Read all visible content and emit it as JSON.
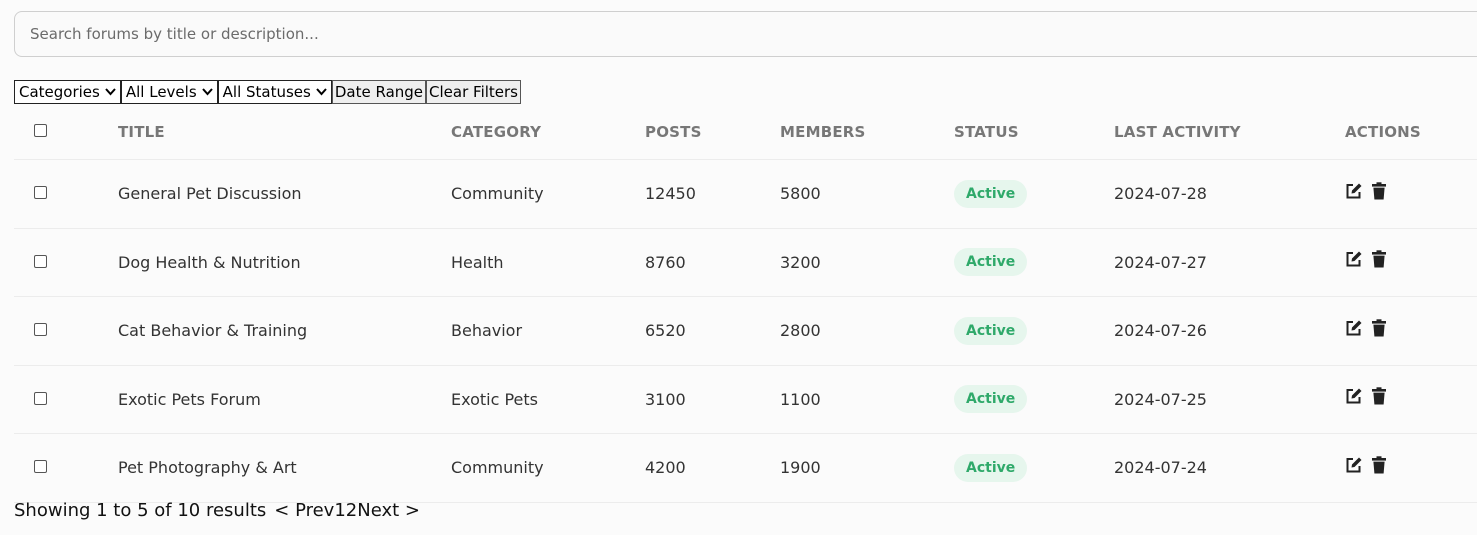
{
  "search": {
    "placeholder": "Search forums by title or description..."
  },
  "filters": {
    "categories": "Categories",
    "levels": "All Levels",
    "statuses": "All Statuses",
    "date_range": "Date Range",
    "clear": "Clear Filters"
  },
  "table": {
    "headers": {
      "title": "TITLE",
      "category": "CATEGORY",
      "posts": "POSTS",
      "members": "MEMBERS",
      "status": "STATUS",
      "last_activity": "LAST ACTIVITY",
      "actions": "ACTIONS"
    },
    "rows": [
      {
        "title": "General Pet Discussion",
        "category": "Community",
        "posts": "12450",
        "members": "5800",
        "status": "Active",
        "last_activity": "2024-07-28"
      },
      {
        "title": "Dog Health & Nutrition",
        "category": "Health",
        "posts": "8760",
        "members": "3200",
        "status": "Active",
        "last_activity": "2024-07-27"
      },
      {
        "title": "Cat Behavior & Training",
        "category": "Behavior",
        "posts": "6520",
        "members": "2800",
        "status": "Active",
        "last_activity": "2024-07-26"
      },
      {
        "title": "Exotic Pets Forum",
        "category": "Exotic Pets",
        "posts": "3100",
        "members": "1100",
        "status": "Active",
        "last_activity": "2024-07-25"
      },
      {
        "title": "Pet Photography & Art",
        "category": "Community",
        "posts": "4200",
        "members": "1900",
        "status": "Active",
        "last_activity": "2024-07-24"
      }
    ]
  },
  "footer": {
    "summary": "Showing 1 to 5 of 10 results",
    "prev": "< Prev",
    "page1": "1",
    "page2": "2",
    "next": "Next >"
  },
  "colors": {
    "status_active_text": "#2fa96a",
    "status_active_bg": "#e6f6ed"
  },
  "icons": {
    "edit": "edit-icon",
    "delete": "trash-icon",
    "dropdown": "chevron-down-icon"
  }
}
